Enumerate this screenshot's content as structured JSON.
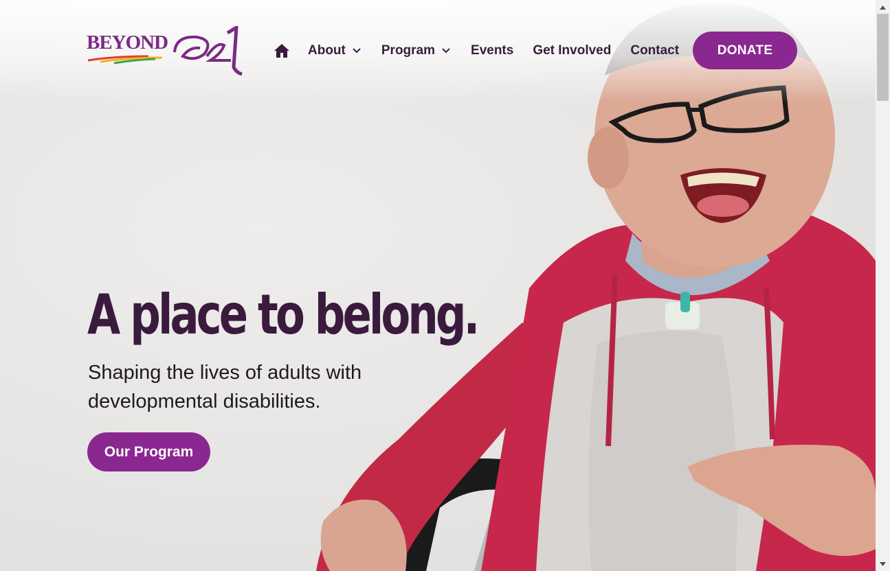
{
  "brand": {
    "name": "BEYOND",
    "accent": "#8a2790",
    "dark_text": "#3a1b3e"
  },
  "nav": {
    "home_icon": "home-icon",
    "items": [
      {
        "label": "About",
        "has_dropdown": true
      },
      {
        "label": "Program",
        "has_dropdown": true
      },
      {
        "label": "Events",
        "has_dropdown": false
      },
      {
        "label": "Get Involved",
        "has_dropdown": false
      },
      {
        "label": "Contact",
        "has_dropdown": false
      }
    ],
    "donate_label": "DONATE"
  },
  "hero": {
    "headline": "A place to belong.",
    "subtitle": "Shaping the lives of adults with developmental disabilities.",
    "cta_label": "Our Program"
  }
}
